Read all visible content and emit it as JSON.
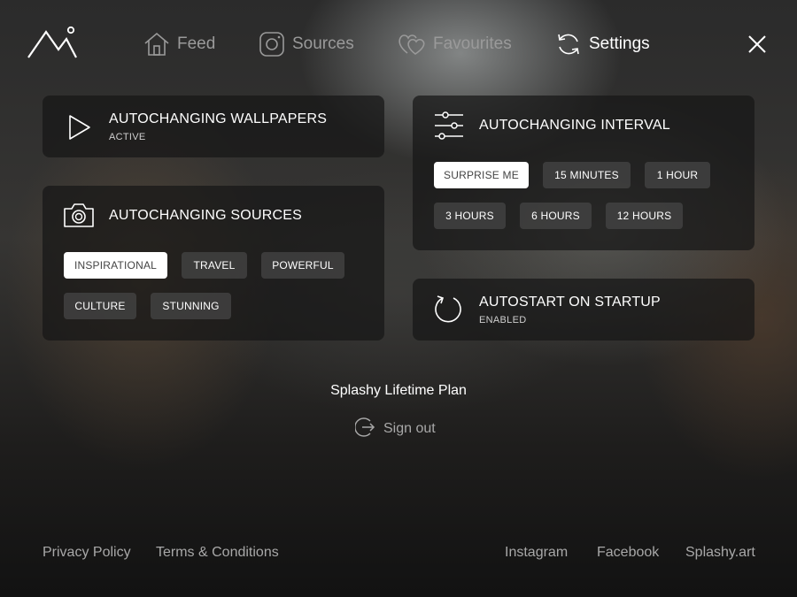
{
  "nav": {
    "feed": "Feed",
    "sources": "Sources",
    "favourites": "Favourites",
    "settings": "Settings"
  },
  "wallpapers": {
    "title": "AUTOCHANGING WALLPAPERS",
    "status": "ACTIVE"
  },
  "sources": {
    "title": "AUTOCHANGING SOURCES",
    "chips": [
      "INSPIRATIONAL",
      "TRAVEL",
      "POWERFUL",
      "CULTURE",
      "STUNNING"
    ],
    "selected": "INSPIRATIONAL"
  },
  "interval": {
    "title": "AUTOCHANGING INTERVAL",
    "chips": [
      "SURPRISE ME",
      "15 MINUTES",
      "1 HOUR",
      "3 HOURS",
      "6 HOURS",
      "12 HOURS"
    ],
    "selected": "SURPRISE ME"
  },
  "autostart": {
    "title": "AUTOSTART ON STARTUP",
    "status": "ENABLED"
  },
  "plan": "Splashy Lifetime Plan",
  "sign_out": "Sign out",
  "footer": {
    "privacy": "Privacy Policy",
    "terms": "Terms & Conditions",
    "instagram": "Instagram",
    "facebook": "Facebook",
    "site": "Splashy.art"
  },
  "colors": {
    "selected_chip_bg": "#ffffff",
    "chip_bg": "#464646",
    "muted_text": "#9a9a9a"
  }
}
